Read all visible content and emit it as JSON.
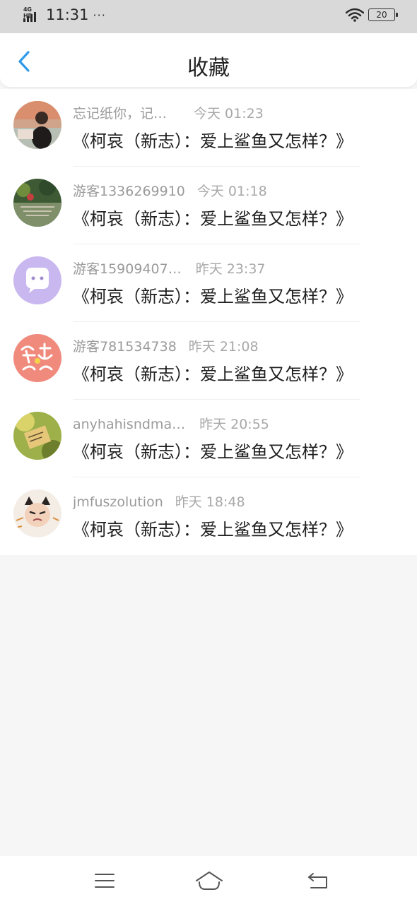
{
  "status_bar": {
    "network": "4G HD",
    "time": "11:31",
    "more": "···",
    "battery": "20"
  },
  "header": {
    "title": "收藏"
  },
  "items": [
    {
      "user": "忘记纸你，记…",
      "time": "今天 01:23",
      "title": "《柯哀（新志）：爱上鲨鱼又怎样？》"
    },
    {
      "user": "游客1336269910",
      "time": "今天 01:18",
      "title": "《柯哀（新志）：爱上鲨鱼又怎样？》"
    },
    {
      "user": "游客15909407…",
      "time": "昨天 23:37",
      "title": "《柯哀（新志）：爱上鲨鱼又怎样？》"
    },
    {
      "user": "游客781534738",
      "time": "昨天 21:08",
      "title": "《柯哀（新志）：爱上鲨鱼又怎样？》"
    },
    {
      "user": "anyhahisndma…",
      "time": "昨天 20:55",
      "title": "《柯哀（新志）：爱上鲨鱼又怎样？》"
    },
    {
      "user": "jmfuszolution",
      "time": "昨天 18:48",
      "title": "《柯哀（新志）：爱上鲨鱼又怎样？》"
    }
  ],
  "colors": {
    "accent": "#2f9be8",
    "background": "#f7f6f7"
  },
  "icons": {
    "back": "chevron-left-icon",
    "menu": "menu-icon",
    "home": "home-icon",
    "return": "return-icon"
  }
}
